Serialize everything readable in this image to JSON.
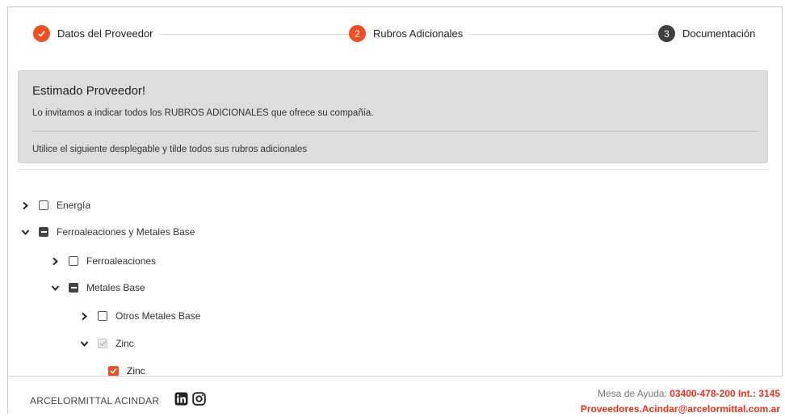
{
  "stepper": {
    "steps": [
      {
        "label": "Datos del Proveedor",
        "number": "✓",
        "state": "done",
        "color": "#f04e23"
      },
      {
        "label": "Rubros Adicionales",
        "number": "2",
        "state": "active",
        "color": "#f04e23"
      },
      {
        "label": "Documentación",
        "number": "3",
        "state": "pending",
        "color": "#3f3f3f"
      }
    ]
  },
  "info": {
    "title": "Estimado Proveedor!",
    "text1": "Lo invitamos a indicar todos los RUBROS ADICIONALES que ofrece su compañía.",
    "text2": "Utilice el siguiente desplegable y tilde todos sus rubros adicionales"
  },
  "tree": [
    {
      "label": "Energía",
      "expanded": false,
      "state": "unchecked"
    },
    {
      "label": "Ferroaleaciones y Metales Base",
      "expanded": true,
      "state": "partial"
    },
    {
      "label": "Ferroaleaciones",
      "expanded": false,
      "state": "unchecked"
    },
    {
      "label": "Metales Base",
      "expanded": true,
      "state": "partial"
    },
    {
      "label": "Otros Metales Base",
      "expanded": false,
      "state": "unchecked"
    },
    {
      "label": "Zinc",
      "expanded": true,
      "state": "disabled-checked"
    },
    {
      "label": "Zinc",
      "expanded": null,
      "state": "checked"
    }
  ],
  "footer": {
    "brand": "ARCELORMITTAL ACINDAR",
    "social_icons": [
      "linkedin-icon",
      "instagram-icon"
    ],
    "help_label": "Mesa de Ayuda: ",
    "help_phone": "03400-478-200 Int.: 3145",
    "help_email": "Proveedores.Acindar@arcelormittal.com.ar"
  },
  "colors": {
    "accent": "#f04e23",
    "info_bg": "#dddddd"
  }
}
